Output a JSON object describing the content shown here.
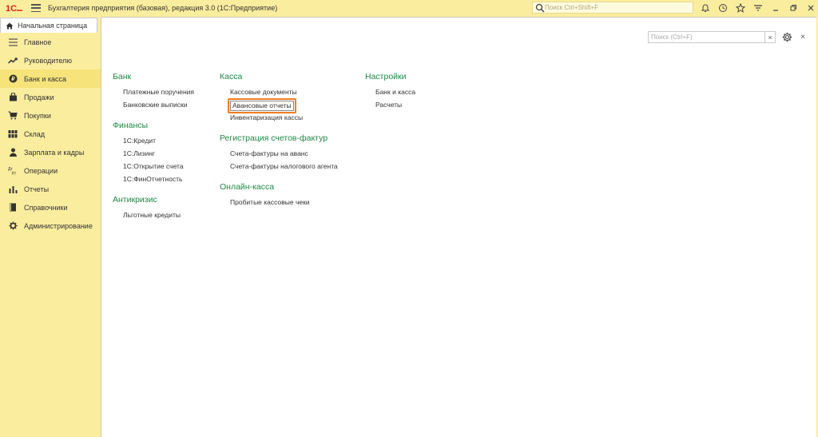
{
  "app": {
    "title": "Бухгалтерия предприятия (базовая), редакция 3.0  (1С:Предприятие)",
    "search_placeholder": "Поиск Ctrl+Shift+F",
    "accent": "#ef7d22",
    "group_color": "#1e8a44",
    "bar_color": "#fbed9e"
  },
  "toolbar": {
    "icons": [
      "bell-icon",
      "history-icon",
      "star-icon",
      "menu-icon",
      "minimize-icon",
      "restore-icon",
      "close-icon"
    ]
  },
  "tabs": {
    "home_label": "Начальная страница"
  },
  "sidebar": {
    "items": [
      {
        "label": "Главное",
        "icon": "menu-icon"
      },
      {
        "label": "Руководителю",
        "icon": "trend-icon"
      },
      {
        "label": "Банк и касса",
        "icon": "bank-icon"
      },
      {
        "label": "Продажи",
        "icon": "bag-icon"
      },
      {
        "label": "Покупки",
        "icon": "cart-icon"
      },
      {
        "label": "Склад",
        "icon": "warehouse-icon"
      },
      {
        "label": "Зарплата и кадры",
        "icon": "person-icon"
      },
      {
        "label": "Операции",
        "icon": "dt-kt-icon"
      },
      {
        "label": "Отчеты",
        "icon": "bar-chart-icon"
      },
      {
        "label": "Справочники",
        "icon": "book-icon"
      },
      {
        "label": "Администрирование",
        "icon": "gear-icon"
      }
    ],
    "active_index": 2
  },
  "panel": {
    "search_placeholder": "Поиск (Ctrl+F)",
    "clear_symbol": "×",
    "close_symbol": "×",
    "columns": [
      {
        "groups": [
          {
            "title": "Банк",
            "items": [
              "Платежные поручения",
              "Банковские выписки"
            ]
          },
          {
            "title": "Финансы",
            "items": [
              "1С:Кредит",
              "1С:Лизинг",
              "1С:Открытие счета",
              "1С:ФинОтчетность"
            ]
          },
          {
            "title": "Антикризис",
            "items": [
              "Льготные кредиты"
            ]
          }
        ]
      },
      {
        "groups": [
          {
            "title": "Касса",
            "items": [
              "Кассовые документы",
              "Авансовые отчеты",
              "Инвентаризация кассы"
            ]
          },
          {
            "title": "Регистрация счетов-фактур",
            "items": [
              "Счета-фактуры на аванс",
              "Счета-фактуры налогового агента"
            ]
          },
          {
            "title": "Онлайн-касса",
            "items": [
              "Пробитые кассовые чеки"
            ]
          }
        ]
      },
      {
        "groups": [
          {
            "title": "Настройки",
            "items": [
              "Банк и касса",
              "Расчеты"
            ]
          }
        ]
      }
    ],
    "highlighted_item": "Авансовые отчеты"
  }
}
